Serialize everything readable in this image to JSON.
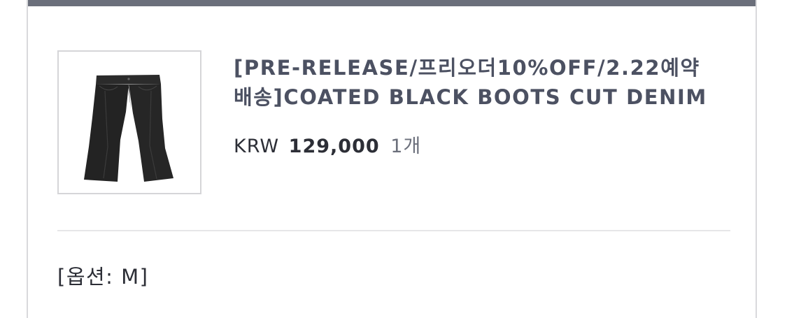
{
  "product": {
    "title": "[PRE-RELEASE/프리오더10%OFF/2.22예약배송]COATED BLACK BOOTS CUT DENIM",
    "currency": "KRW",
    "price": "129,000",
    "quantity": "1개",
    "option": "[옵션: M]",
    "image_icon": "black-flared-jeans-image"
  },
  "colors": {
    "top_bar": "#6b6f7b",
    "title_text": "#4c5162",
    "body_text": "#2c2e36"
  }
}
